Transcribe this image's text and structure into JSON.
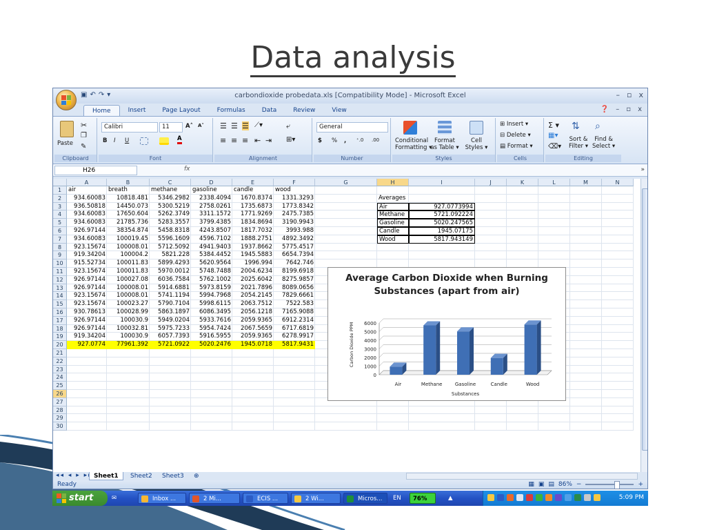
{
  "slide": {
    "title": "Data analysis"
  },
  "window": {
    "title": "carbondioxide probedata.xls  [Compatibility Mode] - Microsoft Excel",
    "minimize": "–",
    "restore": "▫",
    "close": "x"
  },
  "tabs": [
    "Home",
    "Insert",
    "Page Layout",
    "Formulas",
    "Data",
    "Review",
    "View"
  ],
  "ribbon": {
    "groups": [
      "Clipboard",
      "Font",
      "Alignment",
      "Number",
      "Styles",
      "Cells",
      "Editing"
    ],
    "paste": "Paste",
    "font_name": "Calibri",
    "font_size": "11",
    "bold": "B",
    "italic": "I",
    "underline": "U",
    "number_format": "General",
    "currency": "$",
    "percent": "%",
    "comma": ",",
    "conditional_formatting": [
      "Conditional",
      "Formatting ▾"
    ],
    "format_as_table": [
      "Format",
      "as Table ▾"
    ],
    "cell_styles": [
      "Cell",
      "Styles ▾"
    ],
    "insert": "Insert ▾",
    "delete": "Delete ▾",
    "format": "Format ▾",
    "sort_filter": [
      "Sort &",
      "Filter ▾"
    ],
    "find_select": [
      "Find &",
      "Select ▾"
    ]
  },
  "formula_bar": {
    "name_box": "H26",
    "fx": "fx",
    "expand": "»"
  },
  "columns": [
    "A",
    "B",
    "C",
    "D",
    "E",
    "F",
    "G",
    "H",
    "I",
    "J",
    "K",
    "L",
    "M",
    "N"
  ],
  "rows": [
    "1",
    "2",
    "3",
    "4",
    "5",
    "6",
    "7",
    "8",
    "9",
    "10",
    "11",
    "12",
    "13",
    "14",
    "15",
    "16",
    "17",
    "18",
    "19",
    "20",
    "21",
    "22",
    "23",
    "24",
    "25",
    "26",
    "27",
    "28",
    "29",
    "30"
  ],
  "sheet": {
    "headers": [
      "air",
      "breath",
      "methane",
      "gasoline",
      "candle",
      "wood"
    ],
    "data": [
      [
        "934.60083",
        "10818.481",
        "5346.2982",
        "2338.4094",
        "1670.8374",
        "1331.3293"
      ],
      [
        "936.50818",
        "14450.073",
        "5300.5219",
        "2758.0261",
        "1735.6873",
        "1773.8342"
      ],
      [
        "934.60083",
        "17650.604",
        "5262.3749",
        "3311.1572",
        "1771.9269",
        "2475.7385"
      ],
      [
        "934.60083",
        "21785.736",
        "5283.3557",
        "3799.4385",
        "1834.8694",
        "3190.9943"
      ],
      [
        "926.97144",
        "38354.874",
        "5458.8318",
        "4243.8507",
        "1817.7032",
        "3993.988"
      ],
      [
        "934.60083",
        "100019.45",
        "5596.1609",
        "4596.7102",
        "1888.2751",
        "4892.3492"
      ],
      [
        "923.15674",
        "100008.01",
        "5712.5092",
        "4941.9403",
        "1937.8662",
        "5775.4517"
      ],
      [
        "919.34204",
        "100004.2",
        "5821.228",
        "5384.4452",
        "1945.5883",
        "6654.7394"
      ],
      [
        "915.52734",
        "100011.83",
        "5899.4293",
        "5620.9564",
        "1996.994",
        "7642.746"
      ],
      [
        "923.15674",
        "100011.83",
        "5970.0012",
        "5748.7488",
        "2004.6234",
        "8199.6918"
      ],
      [
        "926.97144",
        "100027.08",
        "6036.7584",
        "5762.1002",
        "2025.6042",
        "8275.9857"
      ],
      [
        "926.97144",
        "100008.01",
        "5914.6881",
        "5973.8159",
        "2021.7896",
        "8089.0656"
      ],
      [
        "923.15674",
        "100008.01",
        "5741.1194",
        "5994.7968",
        "2054.2145",
        "7829.6661"
      ],
      [
        "923.15674",
        "100023.27",
        "5790.7104",
        "5998.6115",
        "2063.7512",
        "7522.583"
      ],
      [
        "930.78613",
        "100028.99",
        "5863.1897",
        "6086.3495",
        "2056.1218",
        "7165.9088"
      ],
      [
        "926.97144",
        "100030.9",
        "5949.0204",
        "5933.7616",
        "2059.9365",
        "6912.2314"
      ],
      [
        "926.97144",
        "100032.81",
        "5975.7233",
        "5954.7424",
        "2067.5659",
        "6717.6819"
      ],
      [
        "919.34204",
        "100030.9",
        "6057.7393",
        "5916.5955",
        "2059.9365",
        "6278.9917"
      ]
    ],
    "averages_row": [
      "927.0774",
      "77961.392",
      "5721.0922",
      "5020.2476",
      "1945.0718",
      "5817.9431"
    ]
  },
  "averages_table": {
    "title": "Averages",
    "rows": [
      [
        "Air",
        "927.0773994"
      ],
      [
        "Methane",
        "5721.092224"
      ],
      [
        "Gasoline",
        "5020.247565"
      ],
      [
        "Candle",
        "1945.07175"
      ],
      [
        "Wood",
        "5817.943149"
      ]
    ]
  },
  "chart_data": {
    "type": "bar",
    "title": "Average Carbon Dioxide when Burning  Substances (apart from air)",
    "categories": [
      "Air",
      "Methane",
      "Gasoline",
      "Candle",
      "Wood"
    ],
    "values": [
      927.08,
      5721.09,
      5020.25,
      1945.07,
      5817.94
    ],
    "xlabel": "Substances",
    "ylabel": "Carbon Dioxide PPM",
    "ylim": [
      0,
      6000
    ],
    "yticks": [
      "0",
      "1000",
      "2000",
      "3000",
      "4000",
      "5000",
      "6000"
    ],
    "grid": true,
    "legend": "none",
    "bar_color": "#3f6fb5"
  },
  "sheet_tabs": [
    "Sheet1",
    "Sheet2",
    "Sheet3"
  ],
  "sheet_nav": "◂◂ ◂ ▸ ▸▸",
  "status": {
    "ready": "Ready",
    "zoom": "86%",
    "zoom_out": "−",
    "zoom_in": "+"
  },
  "taskbar": {
    "start": "start",
    "tasks": [
      "Inbox ...",
      "2 Mi...",
      "ECIS ...",
      "2 Wi...",
      "Micros..."
    ],
    "lang": "EN",
    "battery": "76%",
    "clock": "5:09 PM"
  }
}
